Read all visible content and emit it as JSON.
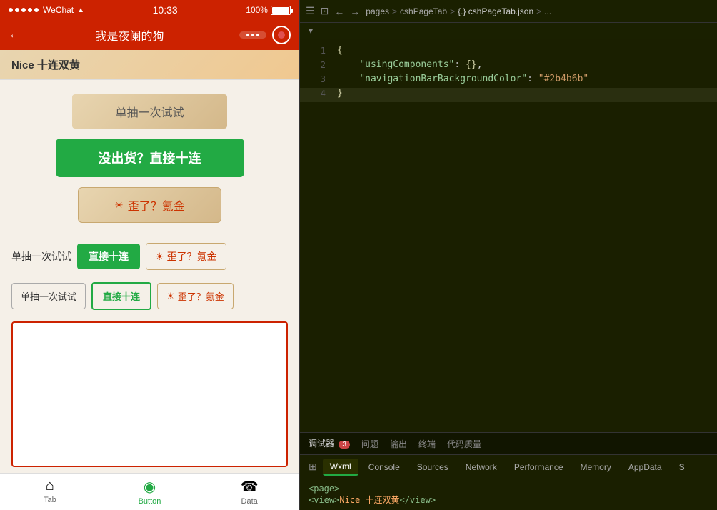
{
  "phone": {
    "statusbar": {
      "signal_dots": 5,
      "carrier": "WeChat",
      "wifi": "📶",
      "time": "10:33",
      "battery_percent": "100%"
    },
    "navbar": {
      "title": "我是夜阑的狗",
      "back_icon": "←"
    },
    "nice_banner": "Nice 十连双黄",
    "buttons": {
      "single_draw": "单抽一次试试",
      "ten_draw": "没出货？直接十连",
      "gale_label": "歪了？氪金",
      "gale_icon": "☀",
      "inline_label": "单抽一次试试",
      "inline_ten": "直接十连",
      "inline_gale": "歪了？氪金",
      "row2_single": "单抽一次试试",
      "row2_ten": "直接十连",
      "row2_gale": "歪了？氪金"
    },
    "tabbar": {
      "tabs": [
        {
          "icon": "⌂",
          "label": "Tab",
          "active": false
        },
        {
          "icon": "◉",
          "label": "Button",
          "active": true
        },
        {
          "icon": "☎",
          "label": "Data",
          "active": false
        }
      ]
    }
  },
  "editor": {
    "toolbar": {
      "hamburger": "☰",
      "bookmark": "⊡",
      "back": "←",
      "forward": "→"
    },
    "breadcrumb": {
      "pages": "pages",
      "sep1": ">",
      "cshPageTab": "cshPageTab",
      "sep2": ">",
      "json_file": "{.} cshPageTab.json",
      "sep3": ">",
      "ellipsis": "..."
    },
    "collapse_symbol": "▾",
    "code_lines": [
      {
        "num": 1,
        "content": "{",
        "type": "brace"
      },
      {
        "num": 2,
        "content": "    \"usingComponents\": {},",
        "key": "usingComponents",
        "value": "{}"
      },
      {
        "num": 3,
        "content": "    \"navigationBarBackgroundColor\": \"#2b4b6b\"",
        "key": "navigationBarBackgroundColor",
        "value": "#2b4b6b"
      },
      {
        "num": 4,
        "content": "}",
        "type": "brace",
        "highlighted": true
      }
    ]
  },
  "bottom_panel": {
    "tabs": [
      {
        "label": "调试器",
        "badge": "3",
        "active": true
      },
      {
        "label": "问题",
        "active": false
      },
      {
        "label": "输出",
        "active": false
      },
      {
        "label": "终端",
        "active": false
      },
      {
        "label": "代码质量",
        "active": false
      }
    ],
    "devtools_tabs": [
      {
        "label": "Wxml",
        "active": true
      },
      {
        "label": "Console",
        "active": false
      },
      {
        "label": "Sources",
        "active": false
      },
      {
        "label": "Network",
        "active": false
      },
      {
        "label": "Performance",
        "active": false
      },
      {
        "label": "Memory",
        "active": false
      },
      {
        "label": "AppData",
        "active": false
      },
      {
        "label": "S",
        "active": false
      }
    ],
    "dom_path": "<page>",
    "dom_preview": "<view>Nice 十连双黄</view>"
  }
}
